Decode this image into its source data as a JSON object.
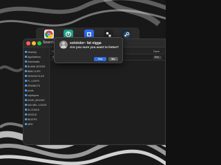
{
  "desktop": {
    "wallpaper": "abstract-black-white-swirls"
  },
  "dock": {
    "items": [
      {
        "name": "chrome-icon",
        "color": "#e8e8e8"
      },
      {
        "name": "app-icon-teal",
        "color": "#1fa58a"
      },
      {
        "name": "app-icon-blue",
        "color": "#2f6cf2"
      },
      {
        "name": "app-icon-dark",
        "color": "#222222"
      },
      {
        "name": "steam-icon",
        "color": "#1b2838"
      }
    ]
  },
  "finder": {
    "title": "Searching",
    "toolbar": {
      "search_label": "Search:",
      "scope_this_mac": "This Mac",
      "scope_folder": "\"Des",
      "save_label": "Save"
    },
    "criteria": {
      "kind": "Kind",
      "right_button": "Any"
    },
    "sidebar": [
      {
        "label": "Desktop"
      },
      {
        "label": "Applications"
      },
      {
        "label": "Downloads"
      },
      {
        "label": "BLANK MOODS"
      },
      {
        "label": "BBM CLIPS"
      },
      {
        "label": "DESIGN FILES"
      },
      {
        "label": "FL LOOPS"
      },
      {
        "label": "DRUMKITS"
      },
      {
        "label": "prods"
      },
      {
        "label": "shpfmpres"
      },
      {
        "label": "DOZE_MOODS"
      },
      {
        "label": "MIX MEL LOOOS"
      },
      {
        "label": "ELOTMOS"
      },
      {
        "label": "MOODS"
      },
      {
        "label": "BEATPS"
      },
      {
        "label": "MPS"
      }
    ]
  },
  "alert": {
    "title": "solslobo~ fat nigga",
    "message": "Are you sure you want to listen?",
    "yes_label": "Yes",
    "no_label": "No"
  },
  "colors": {
    "accent": "#2f6fe0",
    "window_bg": "#1e1e1e",
    "sidebar_bg": "#262626",
    "dialog_bg": "#2c2c2c"
  }
}
